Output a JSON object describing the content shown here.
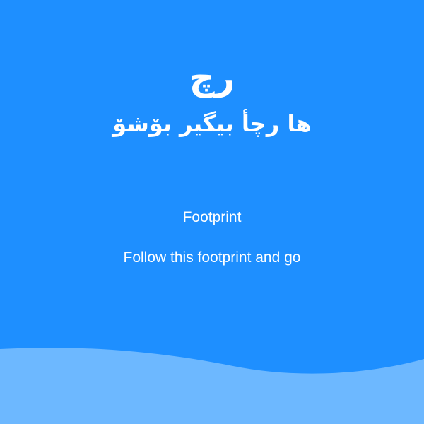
{
  "app": {
    "logo_text": "رچ",
    "name": "ها رچأ بیگیر بۆشۆ"
  },
  "onboarding": {
    "title": "Footprint",
    "description": "Follow this footprint and go"
  },
  "colors": {
    "background": "#1E8FFF",
    "wave": "#6DB8FF",
    "text": "#FFFFFF"
  }
}
